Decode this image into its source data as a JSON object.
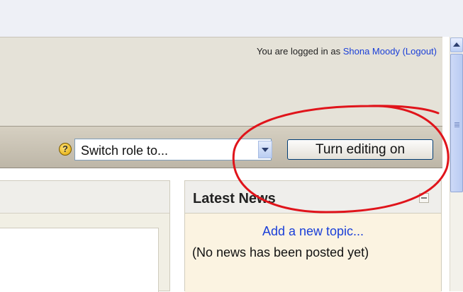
{
  "header": {
    "login_prefix": "You are logged in as",
    "user_name": "Shona Moody",
    "logout_label": "(Logout)"
  },
  "navbar": {
    "help_glyph": "?",
    "switch_role": {
      "selected": "Switch role to..."
    },
    "editing_button_label": "Turn editing on"
  },
  "news_block": {
    "title": "Latest News",
    "add_topic_label": "Add a new topic...",
    "empty_message": "(No news has been posted yet)"
  },
  "annotation_color": "#e0141b",
  "link_color": "#1a3fd8"
}
